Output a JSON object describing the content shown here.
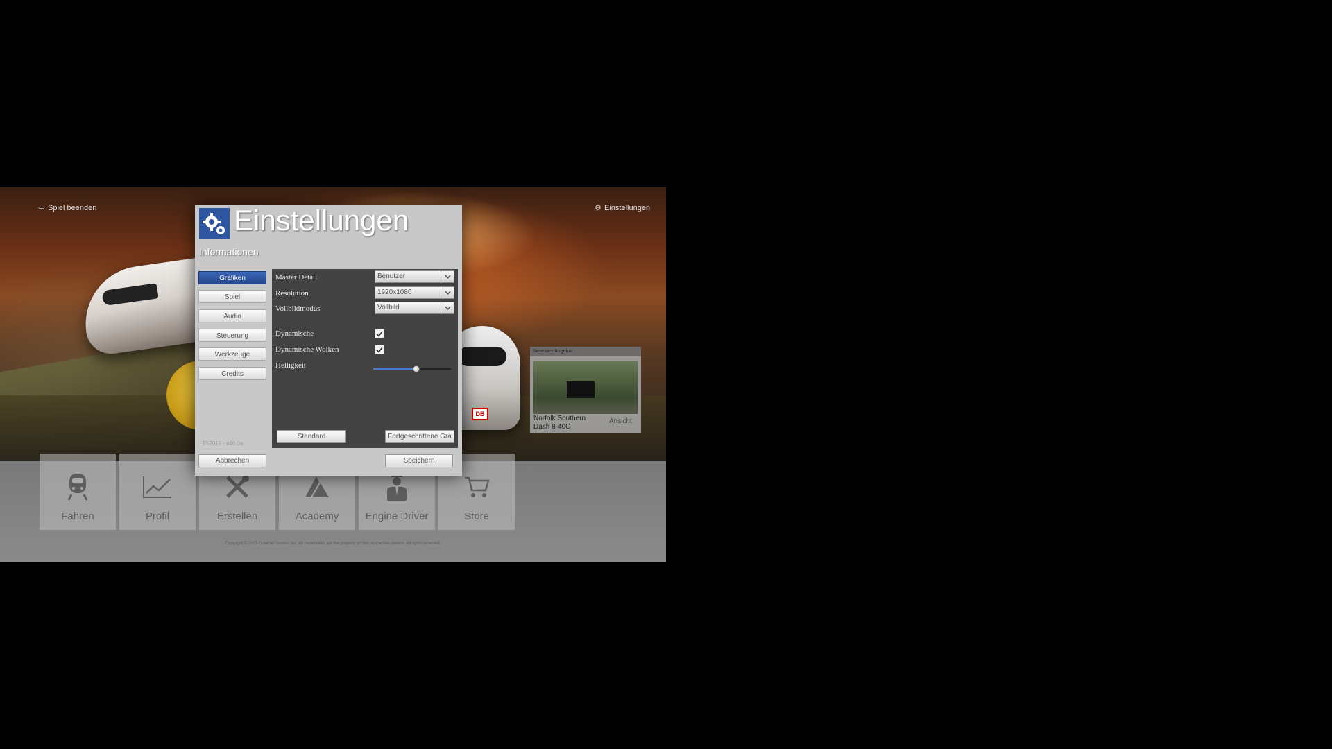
{
  "top_bar": {
    "quit_label": "Spiel beenden",
    "settings_label": "Einstellungen"
  },
  "dialog": {
    "title": "Einstellungen",
    "subtitle": "Informationen",
    "nav": [
      {
        "label": "Grafiken",
        "active": true
      },
      {
        "label": "Spiel",
        "active": false
      },
      {
        "label": "Audio",
        "active": false
      },
      {
        "label": "Steuerung",
        "active": false
      },
      {
        "label": "Werkzeuge",
        "active": false
      },
      {
        "label": "Credits",
        "active": false
      }
    ],
    "version": "TS2015 - v46.0a",
    "settings": {
      "master_detail": {
        "label": "Master Detail",
        "value": "Benutzer"
      },
      "resolution": {
        "label": "Resolution",
        "value": "1920x1080"
      },
      "fullscreen": {
        "label": "Vollbildmodus",
        "value": "Vollbild"
      },
      "dynamic": {
        "label": "Dynamische",
        "checked": true
      },
      "dynamic_clouds": {
        "label": "Dynamische Wolken",
        "checked": true
      },
      "brightness": {
        "label": "Helligkeit",
        "value": 0.55
      }
    },
    "buttons": {
      "standard": "Standard",
      "advanced": "Fortgeschrittene Gra",
      "cancel": "Abbrechen",
      "save": "Speichern"
    }
  },
  "offer": {
    "header": "Neuestes Angebot",
    "name_line1": "Norfolk Southern",
    "name_line2": "Dash 8-40C",
    "view": "Ansicht"
  },
  "tiles": [
    {
      "label": "Fahren",
      "icon": "train-icon"
    },
    {
      "label": "Profil",
      "icon": "chart-icon"
    },
    {
      "label": "Erstellen",
      "icon": "tools-icon"
    },
    {
      "label": "Academy",
      "icon": "academy-icon"
    },
    {
      "label": "Engine Driver",
      "icon": "driver-icon"
    },
    {
      "label": "Store",
      "icon": "cart-icon"
    }
  ],
  "copyright": "Copyright © 2015 Dovetail Games, Inc. All trademarks are the property of their respective owners. All rights reserved.",
  "colors": {
    "accent": "#2f56a0",
    "panel": "#424242",
    "dialog": "#c8c8c8"
  }
}
